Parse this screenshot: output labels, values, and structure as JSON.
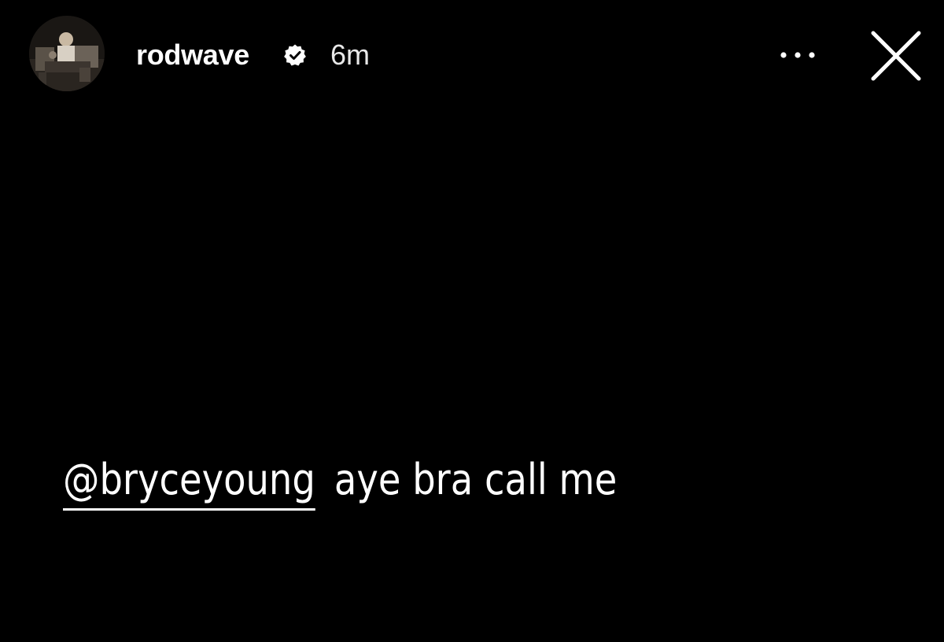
{
  "story": {
    "author": {
      "username": "rodwave",
      "verified": true,
      "timestamp": "6m",
      "avatar_icon": "profile-photo"
    },
    "actions": {
      "more_icon": "more-horizontal-icon",
      "close_icon": "close-icon"
    },
    "caption": {
      "mention": "@bryceyoung",
      "text": "aye bra call me"
    },
    "colors": {
      "background": "#000000",
      "text": "#ffffff"
    }
  }
}
